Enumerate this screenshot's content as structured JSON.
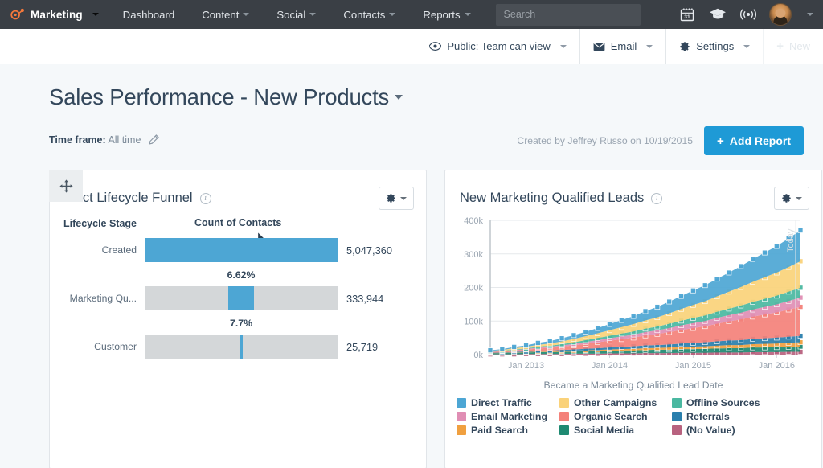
{
  "topnav": {
    "brand": {
      "label": "Marketing",
      "icon": "hubspot-sprocket-icon"
    },
    "items": [
      {
        "label": "Dashboard",
        "caret": false
      },
      {
        "label": "Content",
        "caret": true
      },
      {
        "label": "Social",
        "caret": true
      },
      {
        "label": "Contacts",
        "caret": true
      },
      {
        "label": "Reports",
        "caret": true
      }
    ],
    "search": {
      "placeholder": "Search",
      "value": ""
    },
    "icons": [
      {
        "name": "calendar-icon",
        "label": "31"
      },
      {
        "name": "graduation-cap-icon",
        "label": ""
      },
      {
        "name": "broadcast-icon",
        "label": ""
      }
    ],
    "avatar_alt": "User avatar"
  },
  "subbar": {
    "visibility": "Public: Team can view",
    "email": "Email",
    "settings": "Settings",
    "new": "New",
    "plus": "+"
  },
  "header": {
    "title": "Sales Performance - New Products",
    "timeframe_label": "Time frame:",
    "timeframe_value": "All time",
    "created": "Created by Jeffrey Russo on 10/19/2015",
    "add_report": "Add Report",
    "add_report_plus": "+"
  },
  "funnel_card": {
    "title": "ntact Lifecycle Funnel",
    "col_stage": "Lifecycle Stage",
    "col_count": "Count of Contacts"
  },
  "mql_card": {
    "title": "New Marketing Qualified Leads"
  },
  "chart_data": [
    {
      "type": "bar",
      "title": "Contact Lifecycle Funnel",
      "xlabel": "Count of Contacts",
      "ylabel": "Lifecycle Stage",
      "orientation": "horizontal",
      "categories": [
        "Created",
        "Marketing Qu...",
        "Customer"
      ],
      "values": [
        5047360,
        333944,
        25719
      ],
      "value_labels": [
        "5,047,360",
        "333,944",
        "25,719"
      ],
      "conversion_labels": [
        "",
        "6.62%",
        "7.7%"
      ],
      "bar_fill_pct": [
        100,
        6.62,
        0.51
      ],
      "colors": {
        "fill": "#4da6d4",
        "track": "#d4d7d9"
      }
    },
    {
      "type": "area",
      "stacked": true,
      "title": "New Marketing Qualified Leads",
      "xlabel": "Became a Marketing Qualified Lead Date",
      "ylabel": "",
      "ylim": [
        0,
        400000
      ],
      "ytick_labels": [
        "0k",
        "100k",
        "200k",
        "300k",
        "400k"
      ],
      "ytick_values": [
        0,
        100000,
        200000,
        300000,
        400000
      ],
      "xtick_labels": [
        "Jan 2013",
        "Jan 2014",
        "Jan 2015",
        "Jan 2016"
      ],
      "annotation": "Today",
      "grid": true,
      "legend_position": "bottom",
      "markers": true,
      "series": [
        {
          "name": "Direct Traffic",
          "color": "#4da6d4",
          "values": [
            2,
            3,
            4,
            5,
            6,
            8,
            10,
            12,
            14,
            17,
            20,
            23,
            26,
            30,
            34,
            38,
            42,
            47,
            52,
            57,
            62,
            68,
            74,
            80,
            86,
            93,
            100
          ]
        },
        {
          "name": "Other Campaigns",
          "color": "#fad27a",
          "values": [
            2,
            3,
            4,
            5,
            6,
            7,
            9,
            11,
            13,
            15,
            18,
            21,
            24,
            27,
            30,
            34,
            38,
            42,
            46,
            50,
            55,
            60,
            65,
            70,
            75,
            80,
            86
          ]
        },
        {
          "name": "Offline Sources",
          "color": "#4ab8a1",
          "values": [
            1,
            1,
            2,
            2,
            3,
            3,
            4,
            5,
            6,
            7,
            8,
            9,
            10,
            11,
            12,
            14,
            15,
            17,
            18,
            20,
            21,
            23,
            25,
            26,
            28,
            30,
            32
          ]
        },
        {
          "name": "Email Marketing",
          "color": "#e08eb4",
          "values": [
            1,
            1,
            2,
            2,
            3,
            4,
            4,
            5,
            6,
            7,
            8,
            9,
            10,
            11,
            12,
            13,
            15,
            16,
            17,
            19,
            20,
            22,
            23,
            25,
            26,
            28,
            30
          ]
        },
        {
          "name": "Organic Search",
          "color": "#f4817a",
          "values": [
            2,
            3,
            4,
            6,
            7,
            9,
            11,
            13,
            16,
            19,
            22,
            25,
            28,
            32,
            36,
            40,
            44,
            48,
            52,
            57,
            62,
            67,
            72,
            77,
            82,
            88,
            94
          ]
        },
        {
          "name": "Referrals",
          "color": "#2a7fad",
          "values": [
            1,
            1,
            2,
            2,
            3,
            3,
            4,
            4,
            5,
            6,
            6,
            7,
            8,
            9,
            9,
            10,
            11,
            12,
            13,
            14,
            15,
            16,
            17,
            18,
            19,
            20,
            21
          ]
        },
        {
          "name": "Paid Search",
          "color": "#f0a040",
          "values": [
            0,
            1,
            1,
            1,
            2,
            2,
            2,
            3,
            3,
            4,
            4,
            5,
            5,
            6,
            6,
            7,
            7,
            8,
            8,
            9,
            10,
            10,
            11,
            12,
            12,
            13,
            14
          ]
        },
        {
          "name": "Social Media",
          "color": "#1f8a72",
          "values": [
            4,
            4,
            5,
            5,
            6,
            6,
            7,
            7,
            8,
            8,
            9,
            9,
            10,
            10,
            11,
            11,
            12,
            12,
            13,
            13,
            14,
            14,
            15,
            15,
            16,
            16,
            17
          ]
        },
        {
          "name": "(No Value)",
          "color": "#b8627f",
          "values": [
            1,
            1,
            1,
            2,
            2,
            2,
            2,
            3,
            3,
            3,
            4,
            4,
            4,
            5,
            5,
            5,
            6,
            6,
            6,
            7,
            7,
            7,
            8,
            8,
            8,
            9,
            9
          ]
        }
      ],
      "legend": [
        "Direct Traffic",
        "Other Campaigns",
        "Offline Sources",
        "Email Marketing",
        "Organic Search",
        "Referrals",
        "Paid Search",
        "Social Media",
        "(No Value)"
      ]
    }
  ]
}
